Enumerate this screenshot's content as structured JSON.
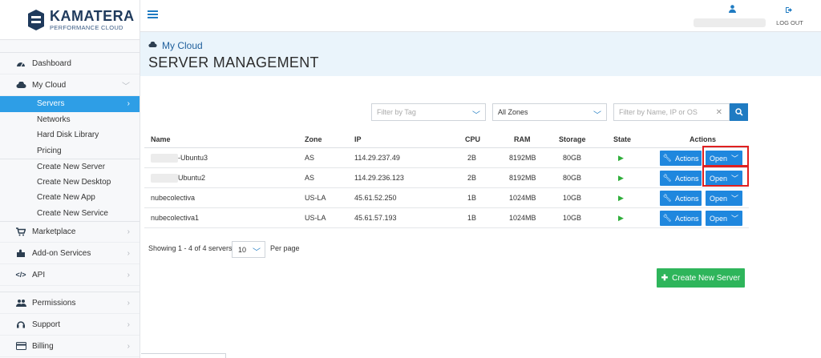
{
  "brand": {
    "title": "KAMATERA",
    "subtitle": "PERFORMANCE CLOUD"
  },
  "topbar": {
    "logout_label": "LOG OUT"
  },
  "sidebar": {
    "dashboard": "Dashboard",
    "my_cloud": "My Cloud",
    "sub_items": [
      "Servers",
      "Networks",
      "Hard Disk Library",
      "Pricing"
    ],
    "create_items": [
      "Create New Server",
      "Create New Desktop",
      "Create New App",
      "Create New Service"
    ],
    "marketplace": "Marketplace",
    "addons": "Add-on Services",
    "api": "API",
    "permissions": "Permissions",
    "support": "Support",
    "billing": "Billing"
  },
  "header": {
    "breadcrumb": "My Cloud",
    "title": "SERVER MANAGEMENT"
  },
  "filters": {
    "tag_placeholder": "Filter by Tag",
    "zone_value": "All Zones",
    "search_placeholder": "Filter by Name, IP or OS"
  },
  "table": {
    "headers": {
      "name": "Name",
      "zone": "Zone",
      "ip": "IP",
      "cpu": "CPU",
      "ram": "RAM",
      "storage": "Storage",
      "state": "State",
      "actions": "Actions"
    },
    "rows": [
      {
        "name": "-Ubuntu3",
        "zone": "AS",
        "ip": "114.29.237.49",
        "cpu": "2B",
        "ram": "8192MB",
        "storage": "80GB"
      },
      {
        "name": "Ubuntu2",
        "zone": "AS",
        "ip": "114.29.236.123",
        "cpu": "2B",
        "ram": "8192MB",
        "storage": "80GB"
      },
      {
        "name": "nubecolectiva",
        "zone": "US-LA",
        "ip": "45.61.52.250",
        "cpu": "1B",
        "ram": "1024MB",
        "storage": "10GB"
      },
      {
        "name": "nubecolectiva1",
        "zone": "US-LA",
        "ip": "45.61.57.193",
        "cpu": "1B",
        "ram": "1024MB",
        "storage": "10GB"
      }
    ],
    "actions_label": "Actions",
    "open_label": "Open"
  },
  "pagination": {
    "showing": "Showing 1 - 4 of 4 servers,",
    "per_page_value": "10",
    "per_page_label": "Per page"
  },
  "create_button": "Create New Server",
  "colors": {
    "accent": "#1f87de",
    "sidebar_active": "#2e9ee6",
    "create": "#2eb55b",
    "highlight": "#e02020",
    "state_running": "#2fae3b"
  }
}
